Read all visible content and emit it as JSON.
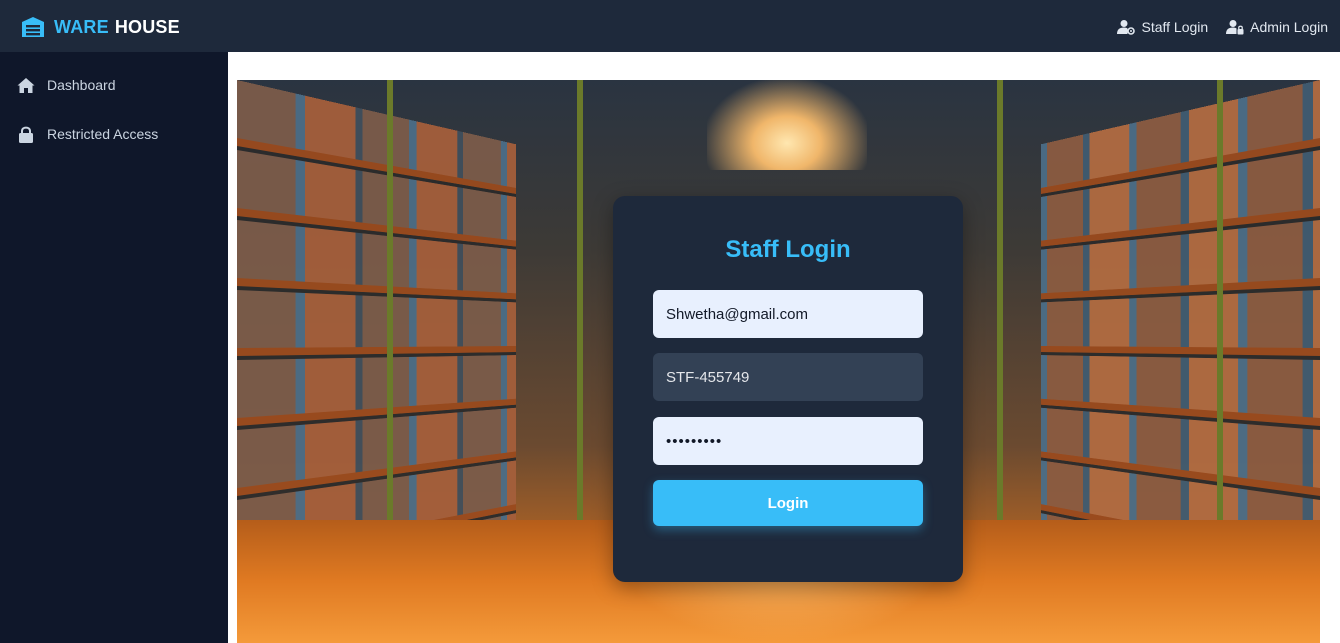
{
  "brand": {
    "part1": "WARE",
    "part2": "HOUSE",
    "icon": "warehouse-icon",
    "accent_color": "#38bdf8"
  },
  "nav": {
    "staff_login": {
      "label": "Staff Login",
      "icon": "user-gear-icon"
    },
    "admin_login": {
      "label": "Admin Login",
      "icon": "user-lock-icon"
    }
  },
  "sidebar": {
    "items": [
      {
        "label": "Dashboard",
        "icon": "home-icon"
      },
      {
        "label": "Restricted Access",
        "icon": "lock-icon"
      }
    ]
  },
  "login_form": {
    "title": "Staff Login",
    "email_value": "Shwetha@gmail.com",
    "staff_id_value": "STF-455749",
    "password_value": "•••••••••",
    "submit_label": "Login"
  }
}
